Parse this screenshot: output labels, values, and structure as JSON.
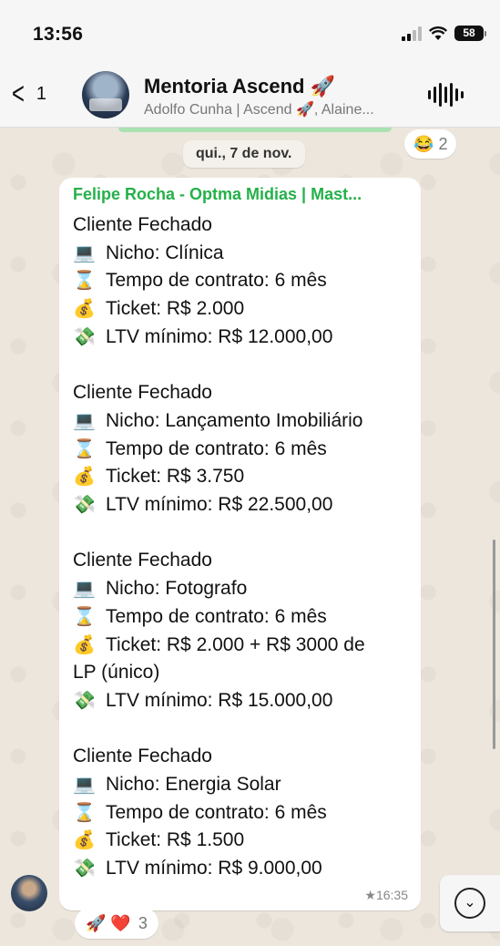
{
  "status_bar": {
    "time": "13:56",
    "battery": "58"
  },
  "header": {
    "back_count": "1",
    "title": "Mentoria Ascend 🚀",
    "subtitle": "Adolfo Cunha | Ascend 🚀, Alaine..."
  },
  "date_chip": "qui., 7 de nov.",
  "top_reaction": {
    "emoji": "😂",
    "count": "2"
  },
  "message": {
    "sender": "Felipe Rocha - Optma Midias | Mast...",
    "time": "★16:35",
    "lines": [
      {
        "emoji": "",
        "text": "Cliente Fechado"
      },
      {
        "emoji": "💻",
        "text": "Nicho: Clínica"
      },
      {
        "emoji": "⌛",
        "text": "Tempo de contrato: 6 mês"
      },
      {
        "emoji": "💰",
        "text": "Ticket: R$ 2.000"
      },
      {
        "emoji": "💸",
        "text": "LTV mínimo: R$ 12.000,00"
      },
      {
        "emoji": "",
        "text": ""
      },
      {
        "emoji": "",
        "text": "Cliente Fechado"
      },
      {
        "emoji": "💻",
        "text": "Nicho: Lançamento Imobiliário"
      },
      {
        "emoji": "⌛",
        "text": "Tempo de contrato: 6 mês"
      },
      {
        "emoji": "💰",
        "text": "Ticket: R$ 3.750"
      },
      {
        "emoji": "💸",
        "text": "LTV mínimo: R$ 22.500,00"
      },
      {
        "emoji": "",
        "text": ""
      },
      {
        "emoji": "",
        "text": "Cliente Fechado"
      },
      {
        "emoji": "💻",
        "text": "Nicho: Fotografo"
      },
      {
        "emoji": "⌛",
        "text": "Tempo de contrato: 6 mês"
      },
      {
        "emoji": "💰",
        "text": "Ticket: R$ 2.000 + R$ 3000 de"
      },
      {
        "emoji": "",
        "text": "LP (único)"
      },
      {
        "emoji": "💸",
        "text": "LTV mínimo: R$ 15.000,00"
      },
      {
        "emoji": "",
        "text": ""
      },
      {
        "emoji": "",
        "text": "Cliente Fechado"
      },
      {
        "emoji": "💻",
        "text": "Nicho: Energia Solar"
      },
      {
        "emoji": "⌛",
        "text": "Tempo de contrato: 6 mês"
      },
      {
        "emoji": "💰",
        "text": "Ticket: R$ 1.500"
      },
      {
        "emoji": "💸",
        "text": "LTV mínimo: R$ 9.000,00"
      }
    ]
  },
  "bottom_reaction": {
    "emojis": "🚀 ❤️",
    "count": "3"
  }
}
